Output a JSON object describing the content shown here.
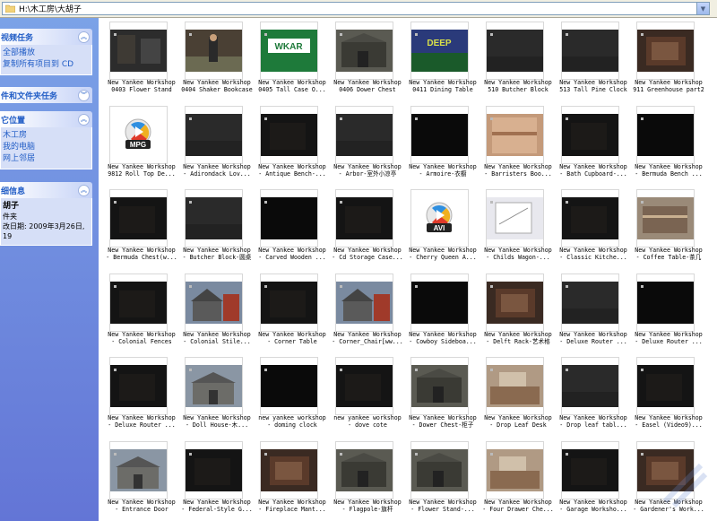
{
  "address": {
    "path": "H:\\木工房\\大胡子",
    "dropdown_glyph": "▼"
  },
  "sidebar": {
    "panels": [
      {
        "title": "视频任务",
        "links": [
          "全部播放",
          "复制所有项目到 CD"
        ]
      },
      {
        "title": "件和文件夹任务",
        "links": []
      },
      {
        "title": "它位置",
        "links": [
          "木工房",
          "我的电脑",
          "网上邻居"
        ]
      },
      {
        "title": "细信息",
        "name": "胡子",
        "type": "件夹",
        "modified": "改日期: 2009年3月26日,",
        "time": "19"
      }
    ]
  },
  "files": [
    {
      "l1": "New Yankee Workshop",
      "l2": "0403 Flower Stand",
      "t": "shop"
    },
    {
      "l1": "New Yankee Workshop",
      "l2": "0404 Shaker Bookcase",
      "t": "man"
    },
    {
      "l1": "New Yankee Workshop",
      "l2": "0405 Tall Case O...",
      "t": "wkar"
    },
    {
      "l1": "New Yankee Workshop",
      "l2": "0406 Dower Chest",
      "t": "barn"
    },
    {
      "l1": "New Yankee Workshop",
      "l2": "0411 Dining Table",
      "t": "deep"
    },
    {
      "l1": "New Yankee Workshop",
      "l2": "510 Butcher Block",
      "t": "dim"
    },
    {
      "l1": "New Yankee Workshop",
      "l2": "513 Tall Pine Clock",
      "t": "dim"
    },
    {
      "l1": "New Yankee Workshop",
      "l2": "911 Greenhouse part2",
      "t": "brown"
    },
    {
      "l1": "New Yankee Workshop",
      "l2": "9812 Roll Top De...",
      "t": "mpg"
    },
    {
      "l1": "New Yankee Workshop",
      "l2": "- Adirondack Lov...",
      "t": "dim"
    },
    {
      "l1": "New Yankee Workshop",
      "l2": "- Antique Bench-...",
      "t": "dark"
    },
    {
      "l1": "New Yankee Workshop",
      "l2": "- Arbor-室外小凉亭",
      "t": "dim"
    },
    {
      "l1": "New Yankee Workshop",
      "l2": "- Armoire-衣橱",
      "t": "black"
    },
    {
      "l1": "New Yankee Workshop",
      "l2": "- Barristers Boo...",
      "t": "wood"
    },
    {
      "l1": "New Yankee Workshop",
      "l2": "- Bath Cupboard-...",
      "t": "dark"
    },
    {
      "l1": "New Yankee Workshop",
      "l2": "- Bermuda Bench ...",
      "t": "black"
    },
    {
      "l1": "New Yankee Workshop",
      "l2": "- Bermuda Chest(w...",
      "t": "dark"
    },
    {
      "l1": "New Yankee Workshop",
      "l2": "- Butcher Block-圆桌",
      "t": "dim"
    },
    {
      "l1": "New Yankee Workshop",
      "l2": "- Carved Wooden ...",
      "t": "black"
    },
    {
      "l1": "New Yankee Workshop",
      "l2": "- Cd Storage Case...",
      "t": "dark"
    },
    {
      "l1": "New Yankee Workshop",
      "l2": "- Cherry Queen A...",
      "t": "avi"
    },
    {
      "l1": "New Yankee Workshop",
      "l2": "- Childs Wagon-...",
      "t": "paper"
    },
    {
      "l1": "New Yankee Workshop",
      "l2": "- Classic Kitche...",
      "t": "dark"
    },
    {
      "l1": "New Yankee Workshop",
      "l2": "- Coffee Table-茶几",
      "t": "bench"
    },
    {
      "l1": "New Yankee Workshop",
      "l2": "- Colonial Fences",
      "t": "dark"
    },
    {
      "l1": "New Yankee Workshop",
      "l2": "- Colonial Stile...",
      "t": "house"
    },
    {
      "l1": "New Yankee Workshop",
      "l2": "- Corner Table",
      "t": "dark"
    },
    {
      "l1": "New Yankee Workshop",
      "l2": "- Corner_Chair[ww...",
      "t": "house"
    },
    {
      "l1": "New Yankee Workshop",
      "l2": "- Cowboy Sideboa...",
      "t": "black"
    },
    {
      "l1": "New Yankee Workshop",
      "l2": "- Delft Rack-艺术格",
      "t": "brown"
    },
    {
      "l1": "New Yankee Workshop",
      "l2": "- Deluxe Router ...",
      "t": "dim"
    },
    {
      "l1": "New Yankee Workshop",
      "l2": "- Deluxe Router ...",
      "t": "black"
    },
    {
      "l1": "New Yankee Workshop",
      "l2": "- Deluxe Router ...",
      "t": "dark"
    },
    {
      "l1": "New Yankee Workshop",
      "l2": "- Doll House-木...",
      "t": "barn2"
    },
    {
      "l1": "new yankee workshop",
      "l2": "- doming clock",
      "t": "black"
    },
    {
      "l1": "new yankee workshop",
      "l2": "- dove cote",
      "t": "dark"
    },
    {
      "l1": "New Yankee Workshop",
      "l2": "- Dower Chest-柜子",
      "t": "barn"
    },
    {
      "l1": "New Yankee Workshop",
      "l2": "- Drop Leaf Desk",
      "t": "shop2"
    },
    {
      "l1": "New Yankee Workshop",
      "l2": "- Drop leaf tabl...",
      "t": "dim"
    },
    {
      "l1": "New Yankee Workshop",
      "l2": "- Easel (Video9)...",
      "t": "dark"
    },
    {
      "l1": "New Yankee Workshop",
      "l2": "- Entrance Door",
      "t": "barn2"
    },
    {
      "l1": "New Yankee Workshop",
      "l2": "- Federal-Style G...",
      "t": "dark"
    },
    {
      "l1": "New Yankee Workshop",
      "l2": "- Fireplace Mant...",
      "t": "brown"
    },
    {
      "l1": "New Yankee Workshop",
      "l2": "- Flagpole-旗杆",
      "t": "barn"
    },
    {
      "l1": "New Yankee Workshop",
      "l2": "- Flower Stand-...",
      "t": "barn"
    },
    {
      "l1": "New Yankee Workshop",
      "l2": "- Four Drawer Che...",
      "t": "shop2"
    },
    {
      "l1": "New Yankee Workshop",
      "l2": "- Garage Worksho...",
      "t": "dark"
    },
    {
      "l1": "New Yankee Workshop",
      "l2": "- Gardener's Work...",
      "t": "brown"
    }
  ],
  "badges": {
    "mpg": "MPG",
    "avi": "AVI",
    "wkar": "WKAR",
    "deep": "DEEP"
  }
}
